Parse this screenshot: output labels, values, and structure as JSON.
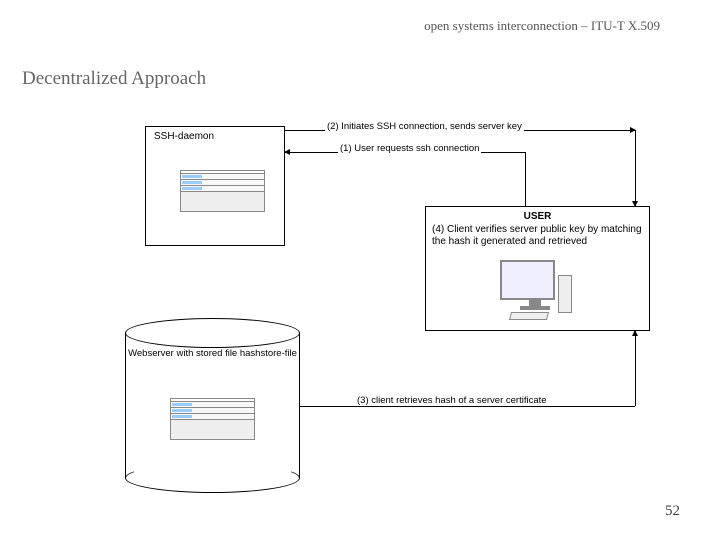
{
  "header": "open systems interconnection – ITU-T X.509",
  "title": "Decentralized Approach",
  "page_number": "52",
  "diagram": {
    "ssh_daemon_label": "SSH-daemon",
    "webserver_label": "Webserver with stored file hashstore-file",
    "user_title": "USER",
    "user_desc": "(4) Client verifies server public key by matching the hash it generated and retrieved",
    "arrow2": "(2) Initiates SSH connection, sends server key",
    "arrow1": "(1) User requests ssh connection",
    "arrow3": "(3) client retrieves hash of a server certificate"
  }
}
